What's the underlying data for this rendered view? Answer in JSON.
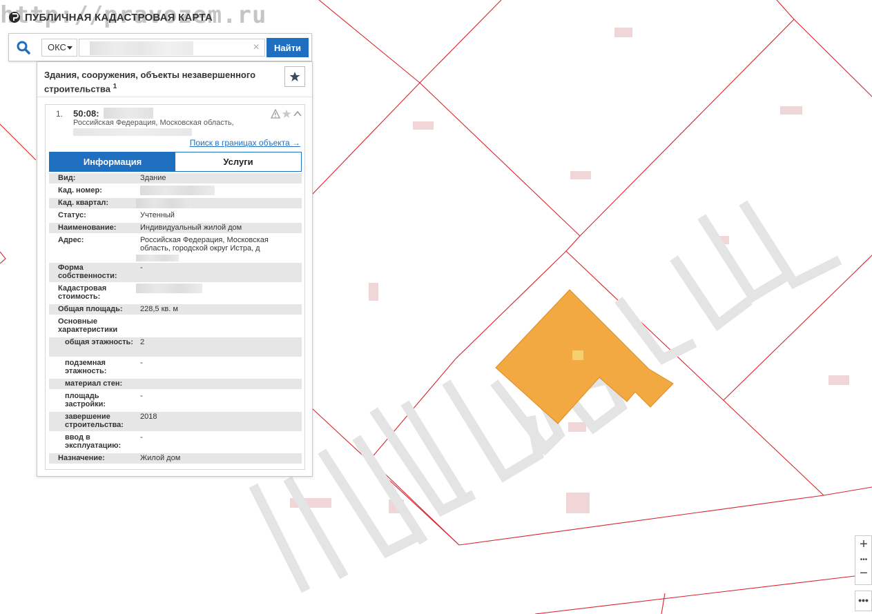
{
  "app": {
    "title": "ПУБЛИЧНАЯ КАДАСТРОВАЯ КАРТА",
    "site_watermark": "http://pravozem.ru"
  },
  "search": {
    "type_label": "ОКС",
    "query_value": "",
    "clear_symbol": "×",
    "find_label": "Найти"
  },
  "results": {
    "header_title": "Здания, сооружения, объекты незавершенного строительства",
    "header_count": "1",
    "item": {
      "index": "1.",
      "cad_number_prefix": "50:08:",
      "address_line": "Российская Федерация, Московская область,",
      "boundary_link": "Поиск в границах объекта →"
    },
    "tabs": [
      {
        "label": "Информация",
        "active": true
      },
      {
        "label": "Услуги",
        "active": false
      }
    ],
    "info": {
      "vid_label": "Вид:",
      "vid_value": "Здание",
      "cad_num_label": "Кад. номер:",
      "cad_kv_label": "Кад. квартал:",
      "status_label": "Статус:",
      "status_value": "Учтенный",
      "name_label": "Наименование:",
      "name_value": "Индивидуальный жилой дом",
      "address_label": "Адрес:",
      "address_value": "Российская Федерация, Московская область, городской округ Истра, д",
      "ownership_label": "Форма собственности:",
      "ownership_value": "-",
      "cost_label": "Кадастровая стоимость:",
      "area_label": "Общая площадь:",
      "area_value": "228,5 кв. м",
      "main_label": "Основные характеристики",
      "floors_label": "общая этажность:",
      "floors_value": "2",
      "underground_label": "подземная этажность:",
      "underground_value": "-",
      "walls_label": "материал стен:",
      "footprint_label": "площадь застройки:",
      "footprint_value": "-",
      "completion_label": "завершение строительства:",
      "completion_value": "2018",
      "commission_label": "ввод в эксплуатацию:",
      "commission_value": "-",
      "purpose_label": "Назначение:",
      "purpose_value": "Жилой дом"
    }
  },
  "map": {
    "parcel_line_color": "#d9242b",
    "building_fill": "#f2a942",
    "watermark_text": "LEHEDEVTEBELL"
  },
  "controls": {
    "zoom_in": "+",
    "zoom_out": "−",
    "dots": "•••",
    "more": "•••"
  }
}
